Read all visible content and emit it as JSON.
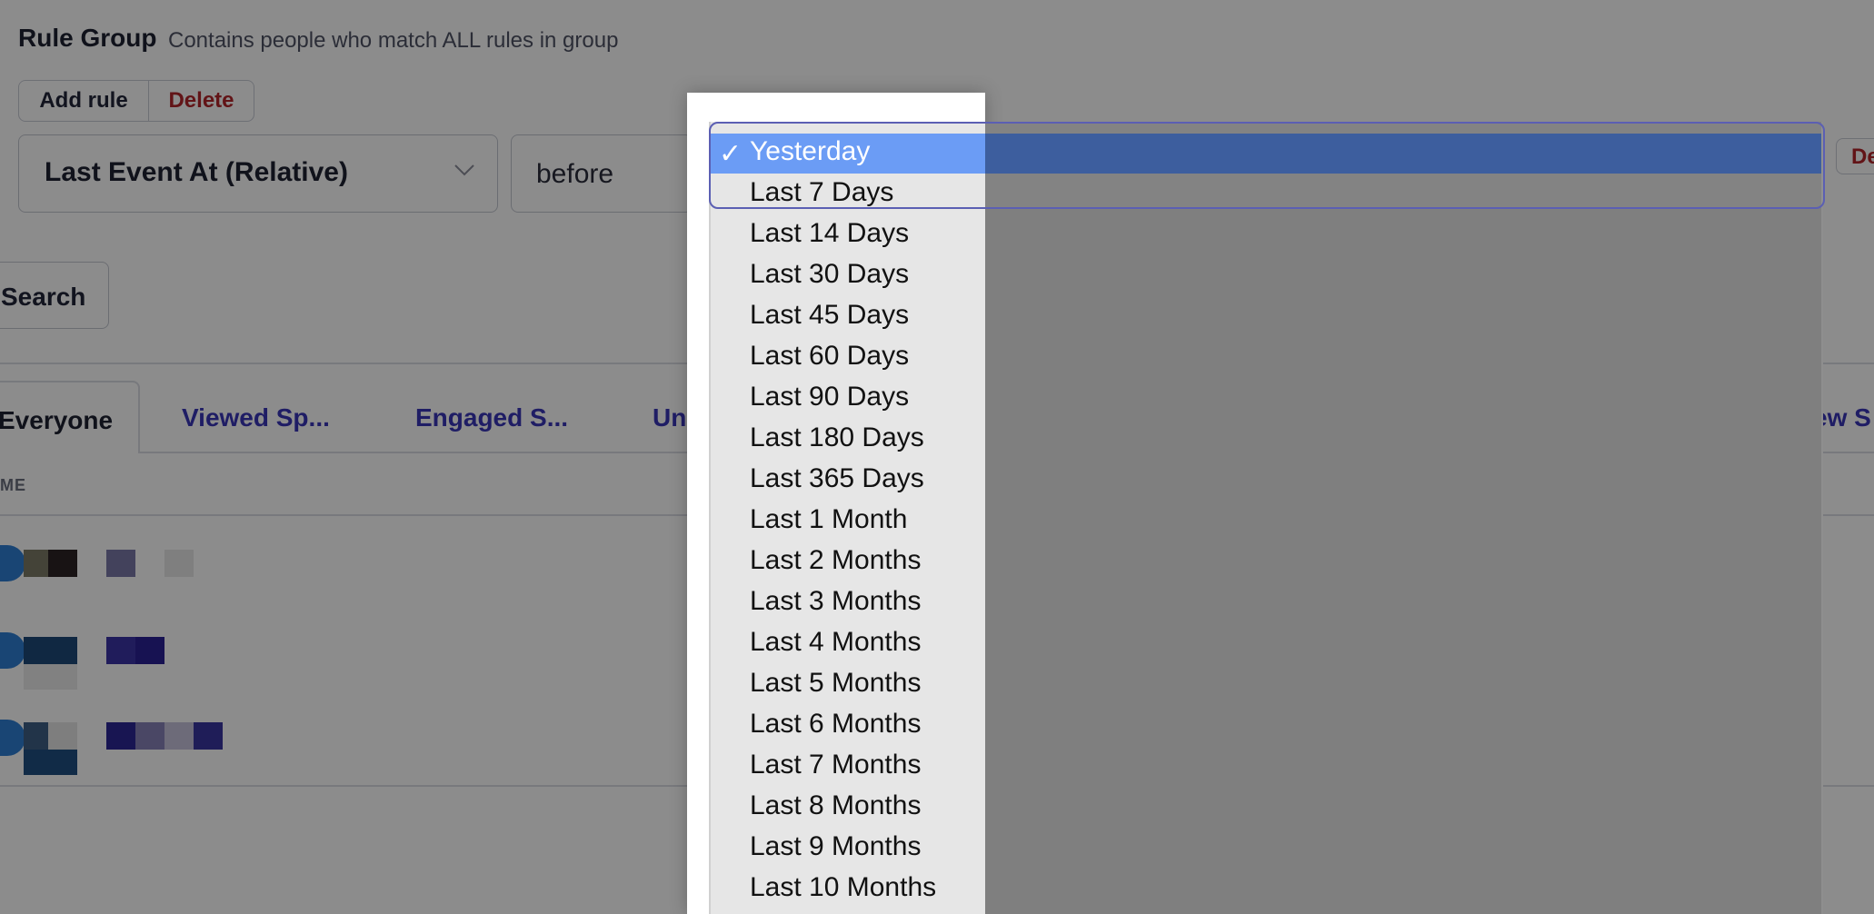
{
  "rule_group": {
    "title": "Rule Group",
    "description": "Contains people who match ALL rules in group",
    "add_rule_label": "Add rule",
    "delete_label": "Delete",
    "field_select_value": "Last Event At (Relative)",
    "operator_value": "before",
    "right_delete_label": "De"
  },
  "search": {
    "label": "Search"
  },
  "tabs": [
    {
      "label": "Everyone",
      "active": true
    },
    {
      "label": "Viewed Sp..."
    },
    {
      "label": "Engaged S..."
    },
    {
      "label": "Uner"
    },
    {
      "label": "ew S"
    }
  ],
  "table": {
    "column_header": "ME"
  },
  "dropdown": {
    "selected": "Yesterday",
    "check_glyph": "✓",
    "options": [
      "Yesterday",
      "Last 7 Days",
      "Last 14 Days",
      "Last 30 Days",
      "Last 45 Days",
      "Last 60 Days",
      "Last 90 Days",
      "Last 180 Days",
      "Last 365 Days",
      "Last 1 Month",
      "Last 2 Months",
      "Last 3 Months",
      "Last 4 Months",
      "Last 5 Months",
      "Last 6 Months",
      "Last 7 Months",
      "Last 8 Months",
      "Last 9 Months",
      "Last 10 Months"
    ]
  },
  "colors": {
    "tab_link": "#3a36b8",
    "delete_text": "#b3262a",
    "highlight": "#6b9cf5",
    "highlight_dark": "#3d5e9e",
    "check_badge": "#2f7fd4"
  }
}
